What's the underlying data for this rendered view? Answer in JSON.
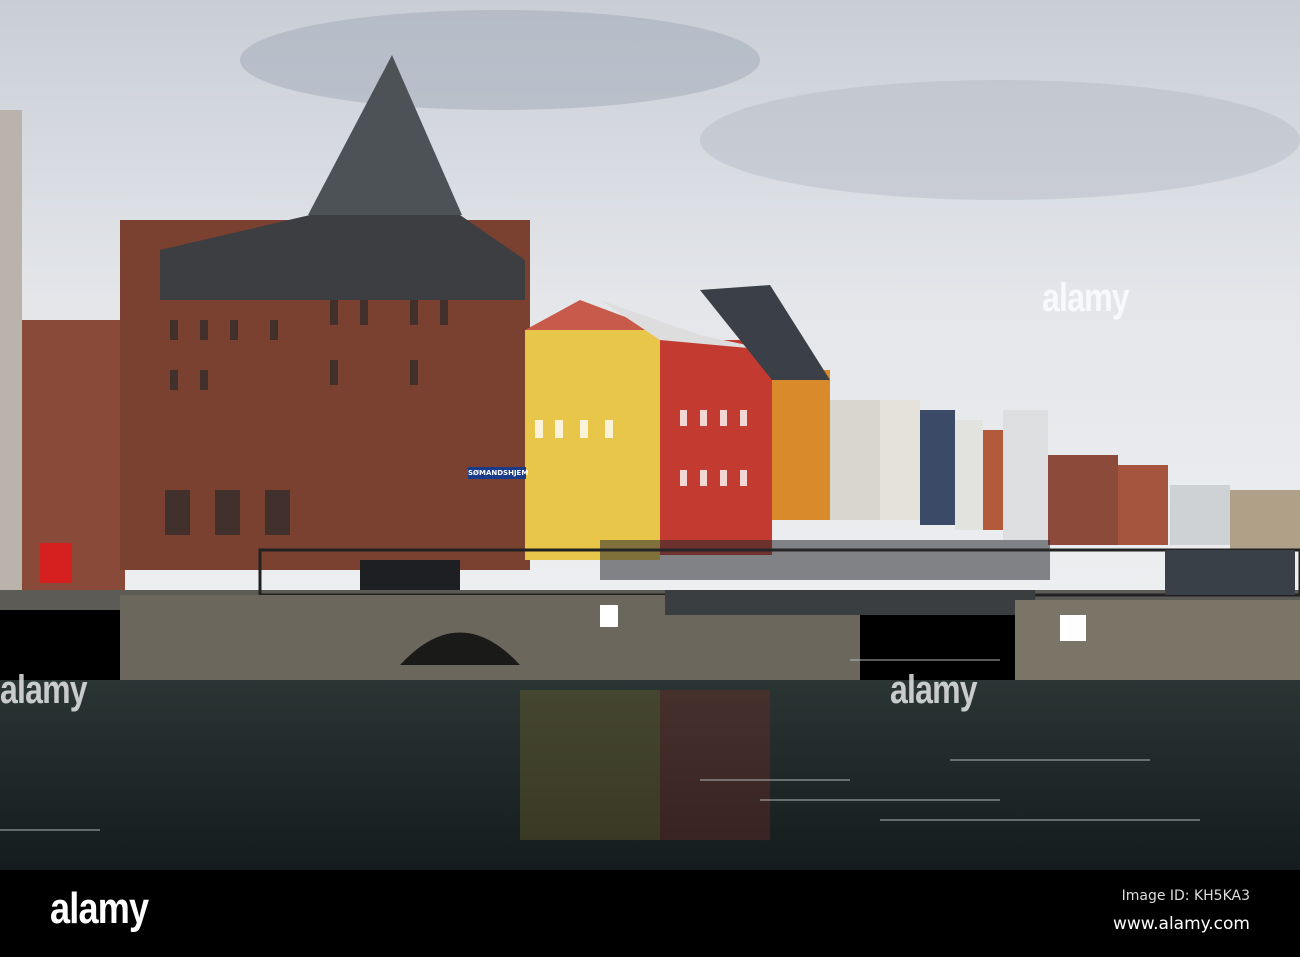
{
  "photo": {
    "sign_text": "SØMANDSHJEM",
    "watermarks": [
      "alamy",
      "alamy",
      "alamy"
    ]
  },
  "footer": {
    "logo": "alamy",
    "image_id": "Image ID: KH5KA3",
    "website": "www.alamy.com"
  },
  "colors": {
    "sky": "#d9dde3",
    "brick": "#7a4030",
    "yellow": "#e8c64a",
    "red": "#c23a30",
    "orange": "#d98a2a",
    "water": "#1c2a2c",
    "footer": "#000000"
  }
}
